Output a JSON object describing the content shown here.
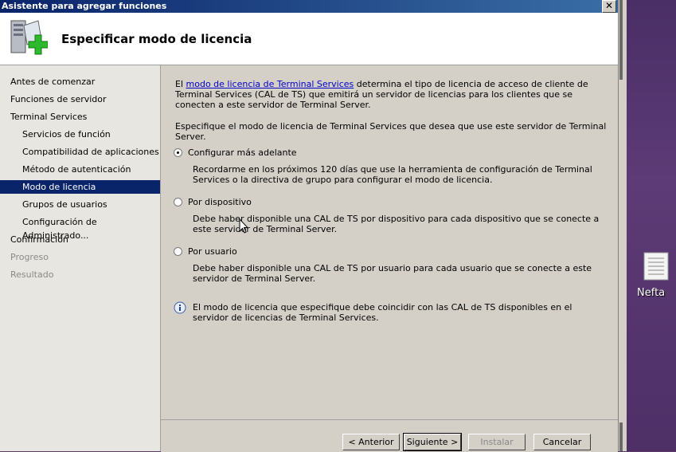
{
  "window": {
    "title": "Asistente para agregar funciones",
    "close_glyph": "✕"
  },
  "header": {
    "title": "Especificar modo de licencia",
    "icon": "server-add-icon"
  },
  "nav": {
    "items": [
      {
        "label": "Antes de comenzar",
        "state": "normal"
      },
      {
        "label": "Funciones de servidor",
        "state": "normal"
      },
      {
        "label": "Terminal Services",
        "state": "normal"
      },
      {
        "label": "Servicios de función",
        "state": "normal"
      },
      {
        "label": "Compatibilidad de aplicaciones",
        "state": "normal"
      },
      {
        "label": "Método de autenticación",
        "state": "normal"
      },
      {
        "label": "Modo de licencia",
        "state": "selected"
      },
      {
        "label": "Grupos de usuarios",
        "state": "normal"
      },
      {
        "label": "Configuración de Administrado...",
        "state": "normal"
      },
      {
        "label": "Confirmación",
        "state": "normal"
      },
      {
        "label": "Progreso",
        "state": "disabled"
      },
      {
        "label": "Resultado",
        "state": "disabled"
      }
    ]
  },
  "content": {
    "intro_prefix": "El ",
    "intro_link": "modo de licencia de Terminal Services",
    "intro_suffix": " determina el tipo de licencia de acceso de cliente de Terminal Services (CAL de TS) que emitirá un servidor de licencias para los clientes que se conecten a este servidor de Terminal Server.",
    "instruction": "Especifique el modo de licencia de Terminal Services que desea que use este servidor de Terminal Server.",
    "options": [
      {
        "label": "Configurar más adelante",
        "checked": true,
        "description": "Recordarme en los próximos 120 días que use la herramienta de configuración de Terminal Services o la directiva de grupo para configurar el modo de licencia."
      },
      {
        "label": "Por dispositivo",
        "checked": false,
        "description": "Debe haber disponible una CAL de TS por dispositivo para cada dispositivo que se conecte a este servidor de Terminal Server."
      },
      {
        "label": "Por usuario",
        "checked": false,
        "description": "Debe haber disponible una CAL de TS por usuario para cada usuario que se conecte a este servidor de Terminal Server."
      }
    ],
    "info_icon": "info-icon",
    "info_text": "El modo de licencia que especifique debe coincidir con las CAL de TS disponibles en el servidor de licencias de Terminal Services."
  },
  "buttons": {
    "back": "< Anterior",
    "next": "Siguiente >",
    "install": "Instalar",
    "cancel": "Cancelar"
  },
  "desktop": {
    "icon_label": "Nefta",
    "icon": "document-icon"
  }
}
